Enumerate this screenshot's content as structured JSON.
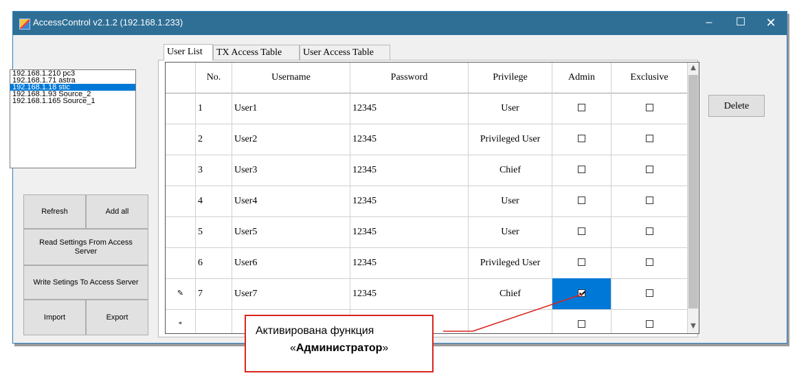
{
  "window": {
    "title": "AccessControl v2.1.2 (192.168.1.233)",
    "controls": {
      "minimize": "–",
      "maximize": "☐",
      "close": "✕"
    }
  },
  "hosts": [
    "192.168.1.210 pc3",
    "192.168.1.71 astra",
    "192.168.1.18 stic",
    "192.168.1.93 Source_2",
    "192.168.1.165 Source_1"
  ],
  "selected_host_index": 2,
  "buttons": {
    "refresh": "Refresh",
    "add_all": "Add all",
    "read_settings_l1": "Read Settings From Access",
    "read_settings_l2": "Server",
    "write_settings": "Write Setings To Access Server",
    "import": "Import",
    "export": "Export",
    "delete": "Delete"
  },
  "tabs": [
    "User List",
    "TX Access Table",
    "User Access Table"
  ],
  "active_tab": 0,
  "columns": [
    "No.",
    "Username",
    "Password",
    "Privilege",
    "Admin",
    "Exclusive"
  ],
  "rows": [
    {
      "marker": "",
      "no": "1",
      "username": "User1",
      "password": "12345",
      "privilege": "User",
      "admin": false,
      "exclusive": false
    },
    {
      "marker": "",
      "no": "2",
      "username": "User2",
      "password": "12345",
      "privilege": "Privileged User",
      "admin": false,
      "exclusive": false
    },
    {
      "marker": "",
      "no": "3",
      "username": "User3",
      "password": "12345",
      "privilege": "Chief",
      "admin": false,
      "exclusive": false
    },
    {
      "marker": "",
      "no": "4",
      "username": "User4",
      "password": "12345",
      "privilege": "User",
      "admin": false,
      "exclusive": false
    },
    {
      "marker": "",
      "no": "5",
      "username": "User5",
      "password": "12345",
      "privilege": "User",
      "admin": false,
      "exclusive": false
    },
    {
      "marker": "",
      "no": "6",
      "username": "User6",
      "password": "12345",
      "privilege": "Privileged User",
      "admin": false,
      "exclusive": false
    },
    {
      "marker": "✎",
      "no": "7",
      "username": "User7",
      "password": "12345",
      "privilege": "Chief",
      "admin": true,
      "exclusive": false
    },
    {
      "marker": "*",
      "no": "",
      "username": "",
      "password": "",
      "privilege": "",
      "admin": false,
      "exclusive": false
    }
  ],
  "callout": {
    "line1": "Активирована функция",
    "open_quote": "«",
    "bold": "Администратор",
    "close_quote": "»"
  },
  "colors": {
    "titlebar": "#2f6f96",
    "selection": "#0078d7",
    "callout_border": "#d9231d"
  }
}
